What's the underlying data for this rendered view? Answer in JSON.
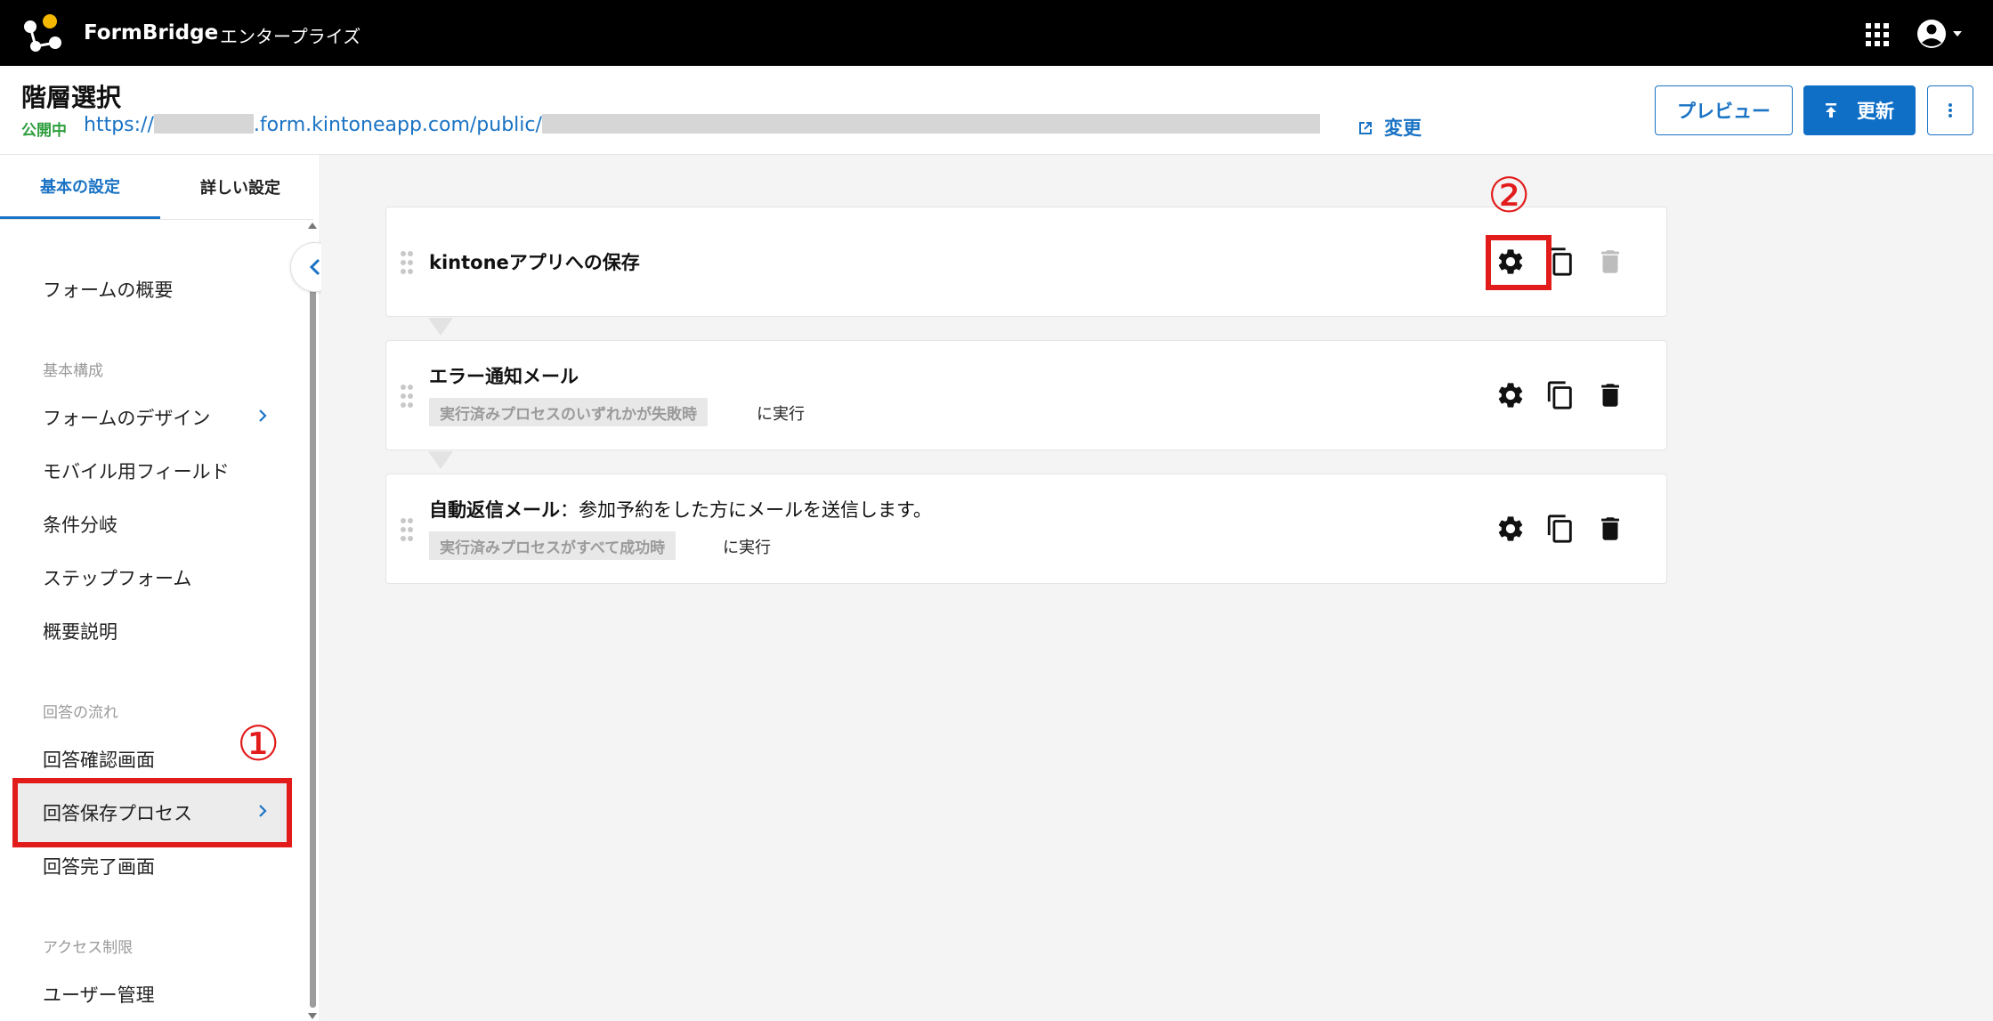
{
  "topbar": {
    "brand": "FormBridge",
    "edition": "エンタープライズ"
  },
  "header": {
    "title": "階層選択",
    "status": "公開中",
    "url_prefix": "https://",
    "url_middle": ".form.kintoneapp.com/public/",
    "change_label": "変更",
    "preview_label": "プレビュー",
    "update_label": "更新"
  },
  "sidebar": {
    "tabs": [
      {
        "label": "基本の設定",
        "active": true
      },
      {
        "label": "詳しい設定",
        "active": false
      }
    ],
    "overview": "フォームの概要",
    "section_basic": "基本構成",
    "design": "フォームのデザイン",
    "mobile": "モバイル用フィールド",
    "branch": "条件分岐",
    "step": "ステップフォーム",
    "summary": "概要説明",
    "section_flow": "回答の流れ",
    "confirm": "回答確認画面",
    "save_process": "回答保存プロセス",
    "complete": "回答完了画面",
    "section_access": "アクセス制限",
    "user_mgmt": "ユーザー管理"
  },
  "annotations": {
    "marker1": "①",
    "marker2": "②",
    "highlight_color": "#e21b1b"
  },
  "processes": [
    {
      "title": "kintoneアプリへの保存",
      "desc": "",
      "condition": "",
      "suffix": "",
      "delete_disabled": true
    },
    {
      "title": "エラー通知メール",
      "desc": "",
      "condition": "実行済みプロセスのいずれかが失敗時",
      "suffix": "に実行",
      "delete_disabled": false
    },
    {
      "title": "自動返信メール",
      "desc": "：参加予約をした方にメールを送信します。",
      "condition": "実行済みプロセスがすべて成功時",
      "suffix": "に実行",
      "delete_disabled": false
    }
  ],
  "colors": {
    "accent": "#1a73c4",
    "status_green": "#2e9e3e",
    "topbar": "#000000"
  }
}
